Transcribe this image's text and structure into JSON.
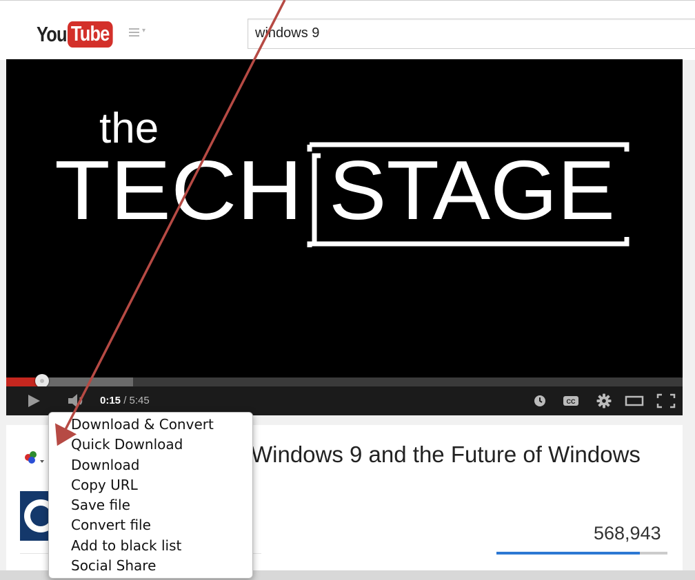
{
  "header": {
    "logo_you": "You",
    "logo_tube": "Tube",
    "search_value": "windows 9"
  },
  "player": {
    "video_title_small": "the",
    "video_title_large_left": "TECH",
    "video_title_large_right": "STAGE",
    "current_time": "0:15",
    "separator": " / ",
    "duration": "5:45",
    "played_fraction": 0.053,
    "buffered_fraction": 0.188,
    "controls": {
      "play": "play-icon",
      "volume": "volume-icon",
      "watch_later": "clock-icon",
      "captions_label": "CC",
      "settings": "gear-icon",
      "theater": "theater-mode-icon",
      "fullscreen": "fullscreen-icon"
    }
  },
  "video_info": {
    "title": "Windows 9 and the Future of Windows",
    "view_count": "568,943",
    "like_fraction": 0.84
  },
  "context_menu": {
    "items": [
      "Download & Convert",
      "Quick Download",
      "Download",
      "Copy URL",
      "Save file",
      "Convert file",
      "Add to black list",
      "Social Share"
    ]
  },
  "colors": {
    "brand_red": "#d3302a",
    "progress_red": "#c5271f",
    "annotation_arrow": "#b64a44",
    "view_bar_blue": "#2d78d3"
  }
}
